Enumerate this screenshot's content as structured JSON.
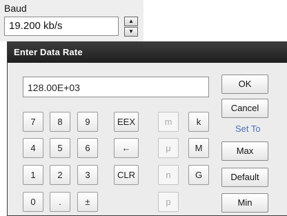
{
  "baud": {
    "label": "Baud",
    "value": "19.200 kb/s",
    "spin_up": "▲",
    "spin_down": "▼"
  },
  "dialog": {
    "title": "Enter Data Rate",
    "input_value": "128.00E+03",
    "keys": {
      "k7": "7",
      "k8": "8",
      "k9": "9",
      "k4": "4",
      "k5": "5",
      "k6": "6",
      "k1": "1",
      "k2": "2",
      "k3": "3",
      "k0": "0",
      "kdot": ".",
      "ksign": "±",
      "eex": "EEX",
      "back": "←",
      "clr": "CLR",
      "milli": "m",
      "micro": "μ",
      "nano": "n",
      "pico": "p",
      "kilo": "k",
      "mega": "M",
      "giga": "G"
    },
    "ok": "OK",
    "cancel": "Cancel",
    "set_to": "Set To",
    "max": "Max",
    "default": "Default",
    "min": "Min"
  }
}
